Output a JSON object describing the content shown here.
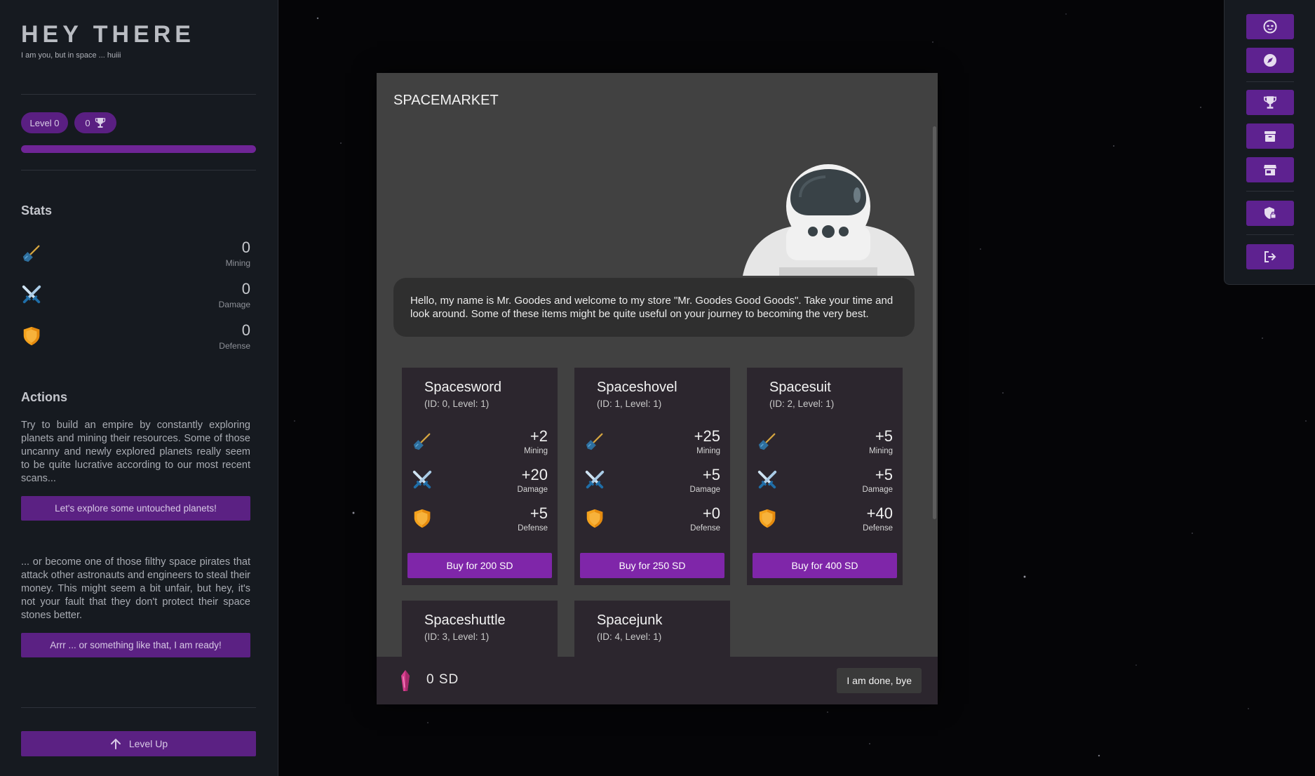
{
  "sidebar": {
    "title": "HEY THERE",
    "subtitle": "I am you, but in space ... huiii",
    "level_label": "Level 0",
    "trophies": "0",
    "xp_progress": 1.0,
    "stats_title": "Stats",
    "stats": [
      {
        "icon": "shovel-icon",
        "value": "0",
        "label": "Mining"
      },
      {
        "icon": "crossed-swords-icon",
        "value": "0",
        "label": "Damage"
      },
      {
        "icon": "shield-icon",
        "value": "0",
        "label": "Defense"
      }
    ],
    "actions_title": "Actions",
    "explore_text": "Try to build an empire by constantly exploring planets and mining their resources. Some of those uncanny and newly explored planets really seem to be quite lucrative according to our most recent scans...",
    "explore_button": "Let's explore some untouched planets!",
    "pirate_text": "... or become one of those filthy space pirates that attack other astronauts and engineers to steal their money. This might seem a bit unfair, but hey, it's not your fault that they don't protect their space stones better.",
    "pirate_button": "Arrr ... or something like that, I am ready!",
    "levelup_button": "Level Up"
  },
  "rightnav": {
    "items": [
      "alien-face-icon",
      "compass-icon",
      "trophy-icon",
      "archive-icon",
      "store-icon",
      "shield-lock-icon",
      "logout-icon"
    ]
  },
  "modal": {
    "title": "SPACEMARKET",
    "greeting": "Hello, my name is Mr. Goodes and welcome to my store \"Mr. Goodes Good Goods\". Take your time and look around. Some of these items might be quite useful on your journey to becoming the very best.",
    "items": [
      {
        "name": "Spacesword",
        "meta": "(ID: 0, Level: 1)",
        "mining": "+2",
        "damage": "+20",
        "defense": "+5",
        "buy": "Buy for 200 SD"
      },
      {
        "name": "Spaceshovel",
        "meta": "(ID: 1, Level: 1)",
        "mining": "+25",
        "damage": "+5",
        "defense": "+0",
        "buy": "Buy for 250 SD"
      },
      {
        "name": "Spacesuit",
        "meta": "(ID: 2, Level: 1)",
        "mining": "+5",
        "damage": "+5",
        "defense": "+40",
        "buy": "Buy for 400 SD"
      },
      {
        "name": "Spaceshuttle",
        "meta": "(ID: 3, Level: 1)"
      },
      {
        "name": "Spacejunk",
        "meta": "(ID: 4, Level: 1)"
      }
    ],
    "stat_labels": {
      "mining": "Mining",
      "damage": "Damage",
      "defense": "Defense"
    },
    "credits": "0 SD",
    "done_button": "I am done, bye"
  },
  "colors": {
    "accent": "#5b2183",
    "buy": "#7f26a9",
    "card": "#2c262e"
  }
}
